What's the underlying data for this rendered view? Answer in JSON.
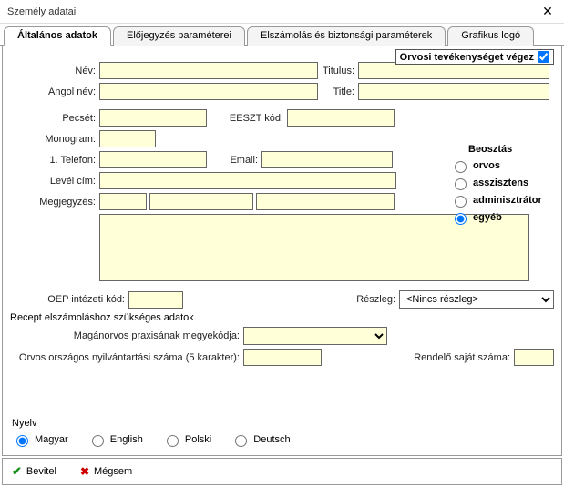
{
  "window": {
    "title": "Személy adatai"
  },
  "tabs": {
    "t1": "Általános adatok",
    "t2": "Előjegyzés paraméterei",
    "t3": "Elszámolás és biztonsági paraméterek",
    "t4": "Grafikus logó"
  },
  "orvosi_label": "Orvosi tevékenységet végez",
  "labels": {
    "nev": "Név:",
    "titulus": "Titulus:",
    "angol": "Angol név:",
    "title": "Title:",
    "pecset": "Pecsét:",
    "eeszt": "EESZT kód:",
    "monogram": "Monogram:",
    "tel1": "1. Telefon:",
    "email": "Email:",
    "level": "Levél cím:",
    "megj": "Megjegyzés:",
    "oep": "OEP intézeti kód:",
    "reszleg": "Részleg:",
    "recept_hdr": "Recept elszámoláshoz szükséges adatok",
    "maganorvos": "Magánorvos praxisának megyekódja:",
    "orvosorsz": "Orvos országos nyilvántartási száma (5 karakter):",
    "rendelo": "Rendelő saját száma:"
  },
  "beosztas": {
    "title": "Beosztás",
    "o1": "orvos",
    "o2": "asszisztens",
    "o3": "adminisztrátor",
    "o4": "egyéb"
  },
  "reszleg_value": "<Nincs részleg>",
  "nyelv": {
    "title": "Nyelv",
    "l1": "Magyar",
    "l2": "English",
    "l3": "Polski",
    "l4": "Deutsch"
  },
  "footer": {
    "ok": "Bevitel",
    "cancel": "Mégsem"
  },
  "fields": {
    "nev": "",
    "titulus": "",
    "angol": "",
    "title": "",
    "pecset": "",
    "eeszt": "",
    "monogram": "",
    "tel1": "",
    "email": "",
    "level": "",
    "megj1": "",
    "megj2": "",
    "megj3": "",
    "notes": "",
    "oep": "",
    "maganorvos": "",
    "orvosorsz": "",
    "rendelo": ""
  }
}
